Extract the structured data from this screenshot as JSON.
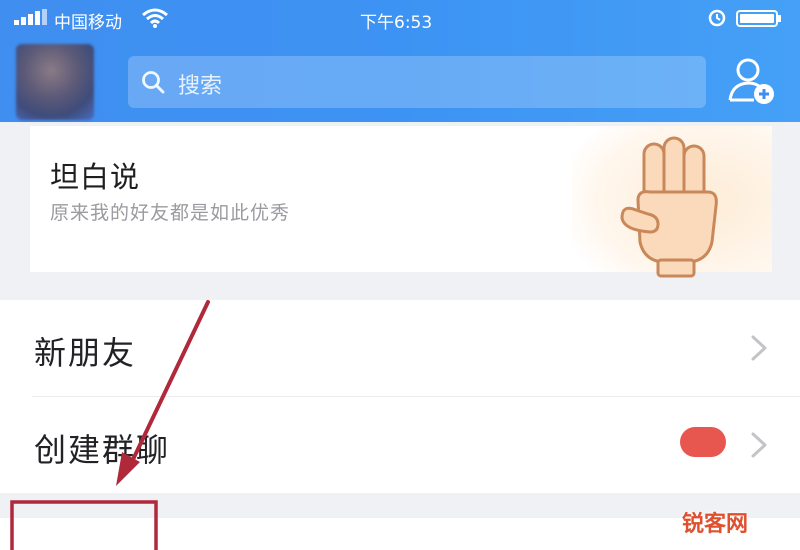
{
  "status_bar": {
    "carrier": "中国移动",
    "time": "下午6:53"
  },
  "header": {
    "search_placeholder": "搜索"
  },
  "card": {
    "title": "坦白说",
    "subtitle": "原来我的好友都是如此优秀"
  },
  "list": {
    "items": [
      {
        "label": "新朋友"
      },
      {
        "label": "创建群聊",
        "badge": "",
        "badge_color": "#e8574f"
      }
    ]
  },
  "watermark": "锐客网",
  "colors": {
    "header_blue": "#3f8ef0",
    "annotation_red": "#b0293a",
    "badge_red": "#e8574f"
  },
  "icons": {
    "signal": "signal-icon",
    "wifi": "wifi-icon",
    "alarm": "alarm-icon",
    "battery": "battery-icon",
    "search": "search-icon",
    "add_friend": "add-friend-icon",
    "hand": "three-finger-hand-icon",
    "chevron": "chevron-right-icon"
  }
}
